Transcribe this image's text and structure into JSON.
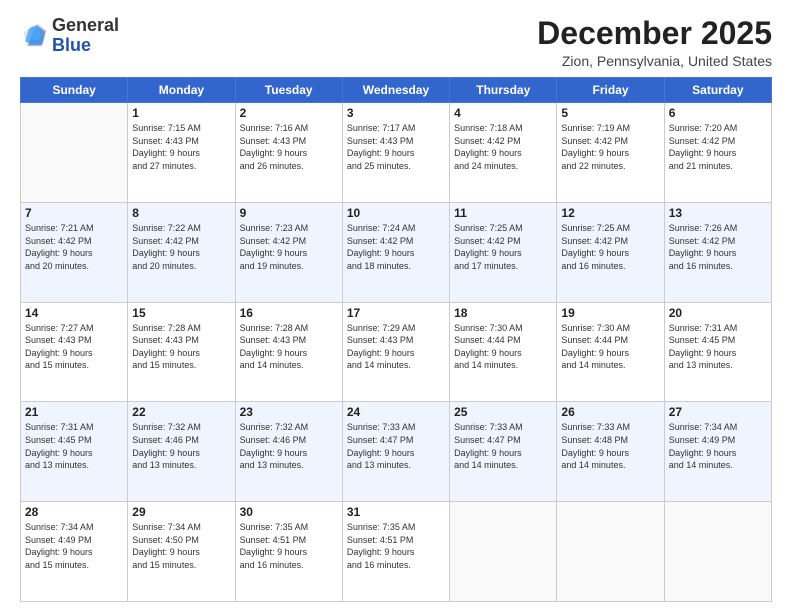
{
  "header": {
    "logo_general": "General",
    "logo_blue": "Blue",
    "month_title": "December 2025",
    "location": "Zion, Pennsylvania, United States"
  },
  "days_of_week": [
    "Sunday",
    "Monday",
    "Tuesday",
    "Wednesday",
    "Thursday",
    "Friday",
    "Saturday"
  ],
  "weeks": [
    [
      {
        "day": "",
        "info": ""
      },
      {
        "day": "1",
        "info": "Sunrise: 7:15 AM\nSunset: 4:43 PM\nDaylight: 9 hours\nand 27 minutes."
      },
      {
        "day": "2",
        "info": "Sunrise: 7:16 AM\nSunset: 4:43 PM\nDaylight: 9 hours\nand 26 minutes."
      },
      {
        "day": "3",
        "info": "Sunrise: 7:17 AM\nSunset: 4:43 PM\nDaylight: 9 hours\nand 25 minutes."
      },
      {
        "day": "4",
        "info": "Sunrise: 7:18 AM\nSunset: 4:42 PM\nDaylight: 9 hours\nand 24 minutes."
      },
      {
        "day": "5",
        "info": "Sunrise: 7:19 AM\nSunset: 4:42 PM\nDaylight: 9 hours\nand 22 minutes."
      },
      {
        "day": "6",
        "info": "Sunrise: 7:20 AM\nSunset: 4:42 PM\nDaylight: 9 hours\nand 21 minutes."
      }
    ],
    [
      {
        "day": "7",
        "info": "Sunrise: 7:21 AM\nSunset: 4:42 PM\nDaylight: 9 hours\nand 20 minutes."
      },
      {
        "day": "8",
        "info": "Sunrise: 7:22 AM\nSunset: 4:42 PM\nDaylight: 9 hours\nand 20 minutes."
      },
      {
        "day": "9",
        "info": "Sunrise: 7:23 AM\nSunset: 4:42 PM\nDaylight: 9 hours\nand 19 minutes."
      },
      {
        "day": "10",
        "info": "Sunrise: 7:24 AM\nSunset: 4:42 PM\nDaylight: 9 hours\nand 18 minutes."
      },
      {
        "day": "11",
        "info": "Sunrise: 7:25 AM\nSunset: 4:42 PM\nDaylight: 9 hours\nand 17 minutes."
      },
      {
        "day": "12",
        "info": "Sunrise: 7:25 AM\nSunset: 4:42 PM\nDaylight: 9 hours\nand 16 minutes."
      },
      {
        "day": "13",
        "info": "Sunrise: 7:26 AM\nSunset: 4:42 PM\nDaylight: 9 hours\nand 16 minutes."
      }
    ],
    [
      {
        "day": "14",
        "info": "Sunrise: 7:27 AM\nSunset: 4:43 PM\nDaylight: 9 hours\nand 15 minutes."
      },
      {
        "day": "15",
        "info": "Sunrise: 7:28 AM\nSunset: 4:43 PM\nDaylight: 9 hours\nand 15 minutes."
      },
      {
        "day": "16",
        "info": "Sunrise: 7:28 AM\nSunset: 4:43 PM\nDaylight: 9 hours\nand 14 minutes."
      },
      {
        "day": "17",
        "info": "Sunrise: 7:29 AM\nSunset: 4:43 PM\nDaylight: 9 hours\nand 14 minutes."
      },
      {
        "day": "18",
        "info": "Sunrise: 7:30 AM\nSunset: 4:44 PM\nDaylight: 9 hours\nand 14 minutes."
      },
      {
        "day": "19",
        "info": "Sunrise: 7:30 AM\nSunset: 4:44 PM\nDaylight: 9 hours\nand 14 minutes."
      },
      {
        "day": "20",
        "info": "Sunrise: 7:31 AM\nSunset: 4:45 PM\nDaylight: 9 hours\nand 13 minutes."
      }
    ],
    [
      {
        "day": "21",
        "info": "Sunrise: 7:31 AM\nSunset: 4:45 PM\nDaylight: 9 hours\nand 13 minutes."
      },
      {
        "day": "22",
        "info": "Sunrise: 7:32 AM\nSunset: 4:46 PM\nDaylight: 9 hours\nand 13 minutes."
      },
      {
        "day": "23",
        "info": "Sunrise: 7:32 AM\nSunset: 4:46 PM\nDaylight: 9 hours\nand 13 minutes."
      },
      {
        "day": "24",
        "info": "Sunrise: 7:33 AM\nSunset: 4:47 PM\nDaylight: 9 hours\nand 13 minutes."
      },
      {
        "day": "25",
        "info": "Sunrise: 7:33 AM\nSunset: 4:47 PM\nDaylight: 9 hours\nand 14 minutes."
      },
      {
        "day": "26",
        "info": "Sunrise: 7:33 AM\nSunset: 4:48 PM\nDaylight: 9 hours\nand 14 minutes."
      },
      {
        "day": "27",
        "info": "Sunrise: 7:34 AM\nSunset: 4:49 PM\nDaylight: 9 hours\nand 14 minutes."
      }
    ],
    [
      {
        "day": "28",
        "info": "Sunrise: 7:34 AM\nSunset: 4:49 PM\nDaylight: 9 hours\nand 15 minutes."
      },
      {
        "day": "29",
        "info": "Sunrise: 7:34 AM\nSunset: 4:50 PM\nDaylight: 9 hours\nand 15 minutes."
      },
      {
        "day": "30",
        "info": "Sunrise: 7:35 AM\nSunset: 4:51 PM\nDaylight: 9 hours\nand 16 minutes."
      },
      {
        "day": "31",
        "info": "Sunrise: 7:35 AM\nSunset: 4:51 PM\nDaylight: 9 hours\nand 16 minutes."
      },
      {
        "day": "",
        "info": ""
      },
      {
        "day": "",
        "info": ""
      },
      {
        "day": "",
        "info": ""
      }
    ]
  ]
}
